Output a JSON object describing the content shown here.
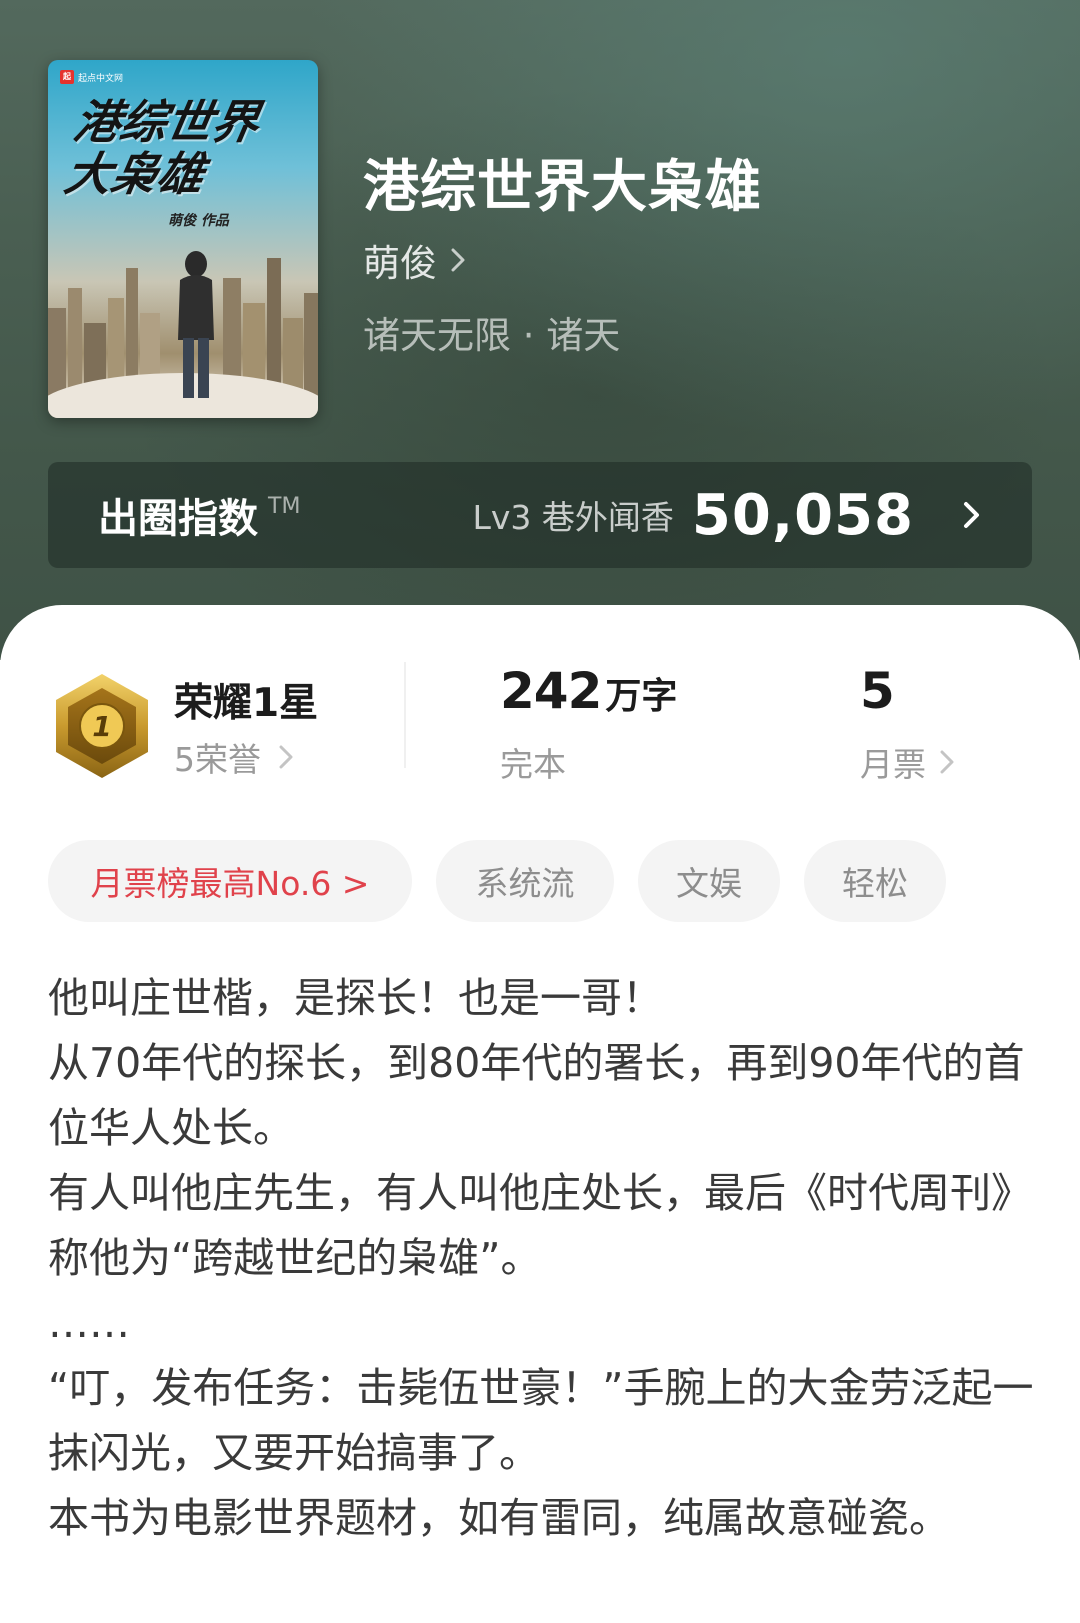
{
  "book": {
    "title": "港综世界大枭雄",
    "author": "萌俊",
    "genre": "诸天无限 · 诸天",
    "cover": {
      "publisher": "起点中文网",
      "publisher_logo": "起",
      "title_line1": "港综世界",
      "title_line2": "大枭雄",
      "author": "萌俊 作品"
    }
  },
  "index_bar": {
    "label": "出圈指数",
    "trademark": "TM",
    "level": "Lv3 巷外闻香",
    "value": "50,058"
  },
  "stats": {
    "honor_title": "荣耀1星",
    "honor_count": "5荣誉",
    "honor_badge_number": "1",
    "word_count": "242",
    "word_unit": "万字",
    "status": "完本",
    "monthly_votes": "5",
    "monthly_votes_label": "月票"
  },
  "tags": {
    "rank": "月票榜最高No.6 >",
    "tag1": "系统流",
    "tag2": "文娱",
    "tag3": "轻松"
  },
  "description": [
    "他叫庄世楷，是探长！也是一哥！",
    "从70年代的探长，到80年代的署长，再到90年代的首位华人处长。",
    "有人叫他庄先生，有人叫他庄处长，最后《时代周刊》称他为“跨越世纪的枭雄”。",
    "……",
    "“叮，发布任务：击毙伍世豪！”手腕上的大金劳泛起一抹闪光，又要开始搞事了。",
    "本书为电影世界题材，如有雷同，纯属故意碰瓷。"
  ],
  "colors": {
    "header_bg": "#4a5f52",
    "rank_tag": "#e0424b",
    "badge_gold": "#c99a2e"
  }
}
